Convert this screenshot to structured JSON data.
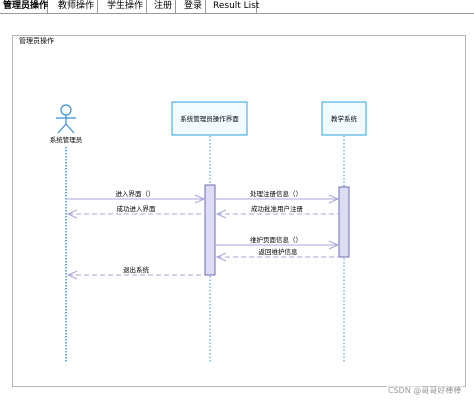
{
  "tabs": [
    {
      "label": "管理员操作",
      "active": true
    },
    {
      "label": "教师操作",
      "active": false
    },
    {
      "label": "学生操作",
      "active": false
    },
    {
      "label": "注册",
      "active": false
    },
    {
      "label": "登录",
      "active": false
    },
    {
      "label": "Result List",
      "active": false
    }
  ],
  "frame": {
    "title": "管理员操作"
  },
  "actor": {
    "label": "系统管理员"
  },
  "lifelines": [
    {
      "label": "系统管理员操作界面"
    },
    {
      "label": "教学系统"
    }
  ],
  "messages": [
    {
      "label": "进入界面（）",
      "kind": "call"
    },
    {
      "label": "成功进入界面",
      "kind": "return"
    },
    {
      "label": "处理注册信息（）",
      "kind": "call"
    },
    {
      "label": "成功批准用户注册",
      "kind": "return"
    },
    {
      "label": "维护页面信息（）",
      "kind": "call"
    },
    {
      "label": "返回维护信息",
      "kind": "return"
    },
    {
      "label": "退出系统",
      "kind": "return"
    }
  ],
  "watermark": "CSDN @哥哥好棒棒",
  "colors": {
    "lifeline": "#3b8fd8",
    "object_border": "#2aa3e0",
    "object_fill": "#f2fbff",
    "activation_fill": "#dcdcf2",
    "activation_border": "#6e6eb4",
    "message_line": "#a7a7d9",
    "actor": "#3b8fd8"
  }
}
